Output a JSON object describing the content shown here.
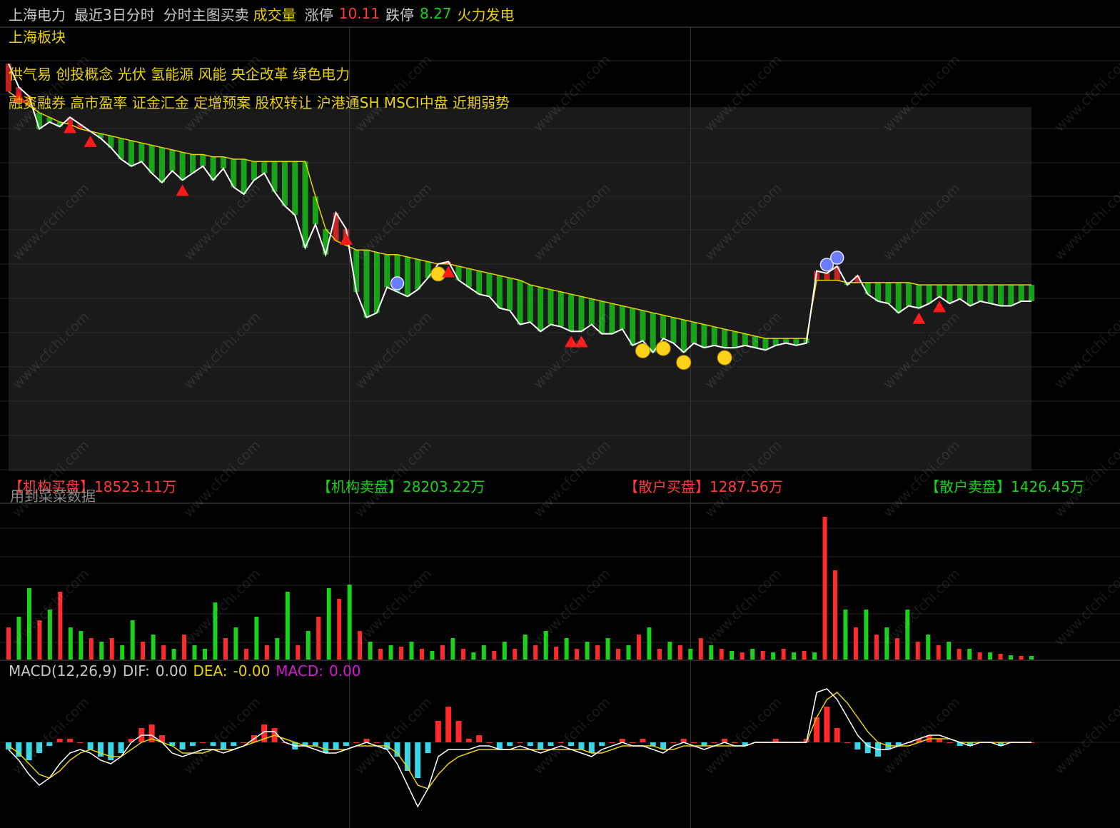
{
  "header": {
    "stock_name": "上海电力",
    "view_label": "最近3日分时",
    "indicator_label": "分时主图买卖",
    "volume_label": "成交量",
    "limit_up_label": "涨停",
    "limit_up_value": "10.11",
    "limit_down_label": "跌停",
    "limit_down_value": "8.27",
    "sector": "火力发电"
  },
  "tags": {
    "line1": "上海板块",
    "line2": "供气易 创投概念 光伏 氢能源 风能 央企改革 绿色电力",
    "line3": "融资融券 高市盈率 证金汇金 定增预案 股权转让 沪港通SH MSCI中盘 近期弱势"
  },
  "flow": {
    "inst_buy_label": "【机构买盘】",
    "inst_buy_value": "18523.11万",
    "inst_sell_label": "【机构卖盘】",
    "inst_sell_value": "28203.22万",
    "retail_buy_label": "【散户买盘】",
    "retail_buy_value": "1287.56万",
    "retail_sell_label": "【散户卖盘】",
    "retail_sell_value": "1426.45万",
    "note": "用到菜菜数据"
  },
  "macd": {
    "label": "MACD(12,26,9)",
    "dif_label": "DIF:",
    "dif_value": "0.00",
    "dea_label": "DEA:",
    "dea_value": "-0.00",
    "macd_label": "MACD:",
    "macd_value": "0.00"
  },
  "watermark": "www.cfchi.com",
  "colors": {
    "price": "#ffffff",
    "avg": "#e8d200",
    "up": "#ff2a2a",
    "down": "#19d219",
    "macd_neg": "#3ad6e6",
    "dea": "#e8d200",
    "dif": "#ffffff",
    "macd_value": "#d21ad2"
  },
  "chart_data": {
    "type": "line",
    "days": 3,
    "series": [
      {
        "name": "price",
        "values": [
          10.02,
          9.92,
          9.88,
          9.74,
          9.77,
          9.75,
          9.79,
          9.76,
          9.73,
          9.7,
          9.66,
          9.61,
          9.58,
          9.6,
          9.55,
          9.51,
          9.56,
          9.52,
          9.55,
          9.58,
          9.52,
          9.57,
          9.49,
          9.46,
          9.52,
          9.55,
          9.47,
          9.41,
          9.37,
          9.23,
          9.33,
          9.2,
          9.38,
          9.31,
          9.04,
          8.93,
          8.95,
          9.06,
          9.04,
          9.02,
          9.05,
          9.1,
          9.16,
          9.17,
          9.09,
          9.06,
          9.03,
          9.02,
          8.97,
          8.96,
          8.9,
          8.91,
          8.87,
          8.9,
          8.89,
          8.87,
          8.87,
          8.9,
          8.86,
          8.86,
          8.88,
          8.81,
          8.83,
          8.78,
          8.84,
          8.82,
          8.78,
          8.82,
          8.8,
          8.81,
          8.8,
          8.8,
          8.81,
          8.8,
          8.79,
          8.81,
          8.82,
          8.81,
          8.82,
          9.13,
          9.12,
          9.15,
          9.07,
          9.11,
          9.03,
          9.0,
          8.99,
          8.95,
          8.98,
          8.97,
          8.99,
          9.02,
          8.99,
          9.01,
          8.98,
          9.0,
          8.99,
          8.98,
          8.98,
          9.0,
          9.0
        ]
      },
      {
        "name": "average",
        "values": [
          9.9,
          9.87,
          9.84,
          9.81,
          9.79,
          9.77,
          9.76,
          9.74,
          9.73,
          9.72,
          9.71,
          9.7,
          9.69,
          9.68,
          9.67,
          9.66,
          9.65,
          9.64,
          9.63,
          9.63,
          9.62,
          9.62,
          9.61,
          9.61,
          9.6,
          9.6,
          9.6,
          9.6,
          9.6,
          9.6,
          9.45,
          9.31,
          9.26,
          9.24,
          9.22,
          9.22,
          9.21,
          9.2,
          9.2,
          9.19,
          9.18,
          9.17,
          9.16,
          9.16,
          9.15,
          9.14,
          9.13,
          9.12,
          9.11,
          9.1,
          9.09,
          9.07,
          9.06,
          9.05,
          9.04,
          9.03,
          9.02,
          9.01,
          9.0,
          8.99,
          8.98,
          8.97,
          8.96,
          8.95,
          8.94,
          8.93,
          8.92,
          8.91,
          8.9,
          8.89,
          8.88,
          8.87,
          8.86,
          8.85,
          8.84,
          8.84,
          8.84,
          8.84,
          8.84,
          9.09,
          9.09,
          9.09,
          9.08,
          9.08,
          9.08,
          9.08,
          9.08,
          9.08,
          9.08,
          9.07,
          9.07,
          9.07,
          9.07,
          9.07,
          9.07,
          9.07,
          9.07,
          9.07,
          9.07,
          9.07,
          9.07
        ]
      }
    ],
    "ylim": [
      8.27,
      10.11
    ],
    "volume": [
      {
        "d": "up",
        "v": 45
      },
      {
        "d": "down",
        "v": 60
      },
      {
        "d": "down",
        "v": 100
      },
      {
        "d": "up",
        "v": 55
      },
      {
        "d": "down",
        "v": 70
      },
      {
        "d": "up",
        "v": 95
      },
      {
        "d": "down",
        "v": 45
      },
      {
        "d": "down",
        "v": 40
      },
      {
        "d": "up",
        "v": 30
      },
      {
        "d": "down",
        "v": 25
      },
      {
        "d": "up",
        "v": 30
      },
      {
        "d": "down",
        "v": 20
      },
      {
        "d": "down",
        "v": 55
      },
      {
        "d": "up",
        "v": 25
      },
      {
        "d": "down",
        "v": 35
      },
      {
        "d": "up",
        "v": 20
      },
      {
        "d": "down",
        "v": 15
      },
      {
        "d": "up",
        "v": 35
      },
      {
        "d": "down",
        "v": 20
      },
      {
        "d": "down",
        "v": 15
      },
      {
        "d": "down",
        "v": 80
      },
      {
        "d": "up",
        "v": 30
      },
      {
        "d": "down",
        "v": 45
      },
      {
        "d": "up",
        "v": 15
      },
      {
        "d": "down",
        "v": 60
      },
      {
        "d": "up",
        "v": 20
      },
      {
        "d": "down",
        "v": 30
      },
      {
        "d": "down",
        "v": 95
      },
      {
        "d": "up",
        "v": 20
      },
      {
        "d": "down",
        "v": 40
      },
      {
        "d": "up",
        "v": 60
      },
      {
        "d": "down",
        "v": 100
      },
      {
        "d": "up",
        "v": 85
      },
      {
        "d": "down",
        "v": 105
      },
      {
        "d": "up",
        "v": 40
      },
      {
        "d": "down",
        "v": 25
      },
      {
        "d": "up",
        "v": 15
      },
      {
        "d": "down",
        "v": 20
      },
      {
        "d": "up",
        "v": 18
      },
      {
        "d": "down",
        "v": 25
      },
      {
        "d": "up",
        "v": 15
      },
      {
        "d": "down",
        "v": 12
      },
      {
        "d": "up",
        "v": 20
      },
      {
        "d": "down",
        "v": 30
      },
      {
        "d": "up",
        "v": 15
      },
      {
        "d": "down",
        "v": 10
      },
      {
        "d": "down",
        "v": 20
      },
      {
        "d": "up",
        "v": 12
      },
      {
        "d": "down",
        "v": 25
      },
      {
        "d": "up",
        "v": 15
      },
      {
        "d": "down",
        "v": 35
      },
      {
        "d": "up",
        "v": 20
      },
      {
        "d": "down",
        "v": 40
      },
      {
        "d": "up",
        "v": 18
      },
      {
        "d": "down",
        "v": 30
      },
      {
        "d": "up",
        "v": 15
      },
      {
        "d": "down",
        "v": 25
      },
      {
        "d": "up",
        "v": 20
      },
      {
        "d": "down",
        "v": 30
      },
      {
        "d": "up",
        "v": 15
      },
      {
        "d": "down",
        "v": 20
      },
      {
        "d": "up",
        "v": 35
      },
      {
        "d": "down",
        "v": 45
      },
      {
        "d": "up",
        "v": 15
      },
      {
        "d": "down",
        "v": 25
      },
      {
        "d": "up",
        "v": 20
      },
      {
        "d": "down",
        "v": 15
      },
      {
        "d": "up",
        "v": 30
      },
      {
        "d": "down",
        "v": 20
      },
      {
        "d": "up",
        "v": 15
      },
      {
        "d": "down",
        "v": 12
      },
      {
        "d": "up",
        "v": 10
      },
      {
        "d": "down",
        "v": 15
      },
      {
        "d": "up",
        "v": 12
      },
      {
        "d": "down",
        "v": 10
      },
      {
        "d": "up",
        "v": 15
      },
      {
        "d": "down",
        "v": 10
      },
      {
        "d": "up",
        "v": 12
      },
      {
        "d": "down",
        "v": 10
      },
      {
        "d": "up",
        "v": 200
      },
      {
        "d": "up",
        "v": 125
      },
      {
        "d": "down",
        "v": 70
      },
      {
        "d": "up",
        "v": 45
      },
      {
        "d": "down",
        "v": 70
      },
      {
        "d": "up",
        "v": 35
      },
      {
        "d": "down",
        "v": 45
      },
      {
        "d": "up",
        "v": 30
      },
      {
        "d": "down",
        "v": 70
      },
      {
        "d": "up",
        "v": 25
      },
      {
        "d": "down",
        "v": 35
      },
      {
        "d": "up",
        "v": 20
      },
      {
        "d": "down",
        "v": 25
      },
      {
        "d": "up",
        "v": 15
      },
      {
        "d": "down",
        "v": 15
      },
      {
        "d": "up",
        "v": 10
      },
      {
        "d": "down",
        "v": 10
      },
      {
        "d": "up",
        "v": 8
      },
      {
        "d": "down",
        "v": 6
      },
      {
        "d": "up",
        "v": 5
      },
      {
        "d": "down",
        "v": 5
      }
    ],
    "macd": {
      "bars": [
        -0.02,
        -0.04,
        -0.05,
        -0.03,
        -0.01,
        0.01,
        0.01,
        0.0,
        -0.02,
        -0.04,
        -0.05,
        -0.03,
        0.01,
        0.04,
        0.05,
        0.02,
        -0.01,
        -0.02,
        -0.01,
        0.0,
        -0.01,
        -0.02,
        -0.01,
        0.0,
        0.02,
        0.05,
        0.04,
        0.0,
        -0.02,
        -0.01,
        -0.01,
        -0.03,
        -0.02,
        -0.01,
        0.0,
        0.01,
        0.0,
        -0.02,
        -0.04,
        -0.08,
        -0.1,
        -0.03,
        0.06,
        0.1,
        0.06,
        0.01,
        0.02,
        0.0,
        -0.02,
        -0.01,
        0.0,
        -0.01,
        -0.02,
        -0.01,
        0.0,
        -0.01,
        -0.02,
        -0.03,
        -0.01,
        0.0,
        0.01,
        0.0,
        0.01,
        -0.01,
        -0.02,
        0.0,
        0.01,
        0.0,
        -0.01,
        0.0,
        0.01,
        0.0,
        -0.01,
        0.0,
        0.0,
        0.01,
        0.0,
        0.0,
        0.01,
        0.07,
        0.1,
        0.04,
        0.0,
        -0.02,
        -0.03,
        -0.04,
        -0.02,
        -0.01,
        0.0,
        0.01,
        0.02,
        0.01,
        0.0,
        -0.01,
        -0.01,
        0.0,
        0.0,
        -0.01,
        0.0,
        0.0,
        0.0
      ],
      "dif": [
        -0.02,
        -0.05,
        -0.09,
        -0.12,
        -0.1,
        -0.06,
        -0.03,
        -0.02,
        -0.03,
        -0.05,
        -0.06,
        -0.04,
        0.0,
        0.02,
        0.02,
        0.0,
        -0.03,
        -0.04,
        -0.03,
        -0.02,
        -0.02,
        -0.03,
        -0.02,
        -0.01,
        0.01,
        0.03,
        0.03,
        0.0,
        -0.01,
        -0.01,
        -0.02,
        -0.03,
        -0.03,
        -0.02,
        -0.01,
        0.0,
        -0.01,
        -0.02,
        -0.06,
        -0.12,
        -0.18,
        -0.13,
        -0.04,
        -0.02,
        -0.02,
        -0.02,
        -0.01,
        -0.01,
        -0.02,
        -0.02,
        -0.01,
        -0.02,
        -0.03,
        -0.02,
        -0.01,
        -0.02,
        -0.03,
        -0.04,
        -0.02,
        -0.01,
        0.0,
        -0.01,
        -0.01,
        -0.02,
        -0.03,
        -0.01,
        0.0,
        -0.01,
        -0.02,
        -0.01,
        0.0,
        -0.01,
        -0.01,
        0.0,
        0.0,
        0.0,
        0.0,
        0.0,
        0.0,
        0.14,
        0.15,
        0.12,
        0.07,
        0.02,
        -0.01,
        -0.02,
        -0.02,
        -0.01,
        0.0,
        0.01,
        0.02,
        0.02,
        0.01,
        0.0,
        -0.01,
        0.0,
        0.0,
        -0.01,
        0.0,
        0.0,
        0.0
      ],
      "dea": [
        -0.01,
        -0.03,
        -0.06,
        -0.09,
        -0.1,
        -0.08,
        -0.05,
        -0.03,
        -0.02,
        -0.03,
        -0.04,
        -0.04,
        -0.02,
        0.0,
        0.01,
        0.0,
        -0.01,
        -0.03,
        -0.03,
        -0.03,
        -0.02,
        -0.02,
        -0.02,
        -0.01,
        0.0,
        0.01,
        0.02,
        0.01,
        0.0,
        -0.01,
        -0.01,
        -0.02,
        -0.02,
        -0.02,
        -0.01,
        -0.01,
        -0.01,
        -0.01,
        -0.03,
        -0.07,
        -0.12,
        -0.13,
        -0.09,
        -0.06,
        -0.04,
        -0.03,
        -0.02,
        -0.02,
        -0.02,
        -0.02,
        -0.02,
        -0.02,
        -0.02,
        -0.02,
        -0.02,
        -0.02,
        -0.02,
        -0.03,
        -0.03,
        -0.02,
        -0.01,
        -0.01,
        -0.01,
        -0.01,
        -0.02,
        -0.02,
        -0.01,
        -0.01,
        -0.01,
        -0.01,
        -0.01,
        -0.01,
        -0.01,
        0.0,
        0.0,
        0.0,
        0.0,
        0.0,
        0.0,
        0.07,
        0.12,
        0.14,
        0.11,
        0.07,
        0.03,
        0.0,
        -0.01,
        -0.01,
        -0.01,
        0.0,
        0.01,
        0.01,
        0.01,
        0.0,
        0.0,
        0.0,
        0.0,
        0.0,
        0.0,
        0.0,
        0.0
      ]
    },
    "signals": [
      {
        "type": "buy",
        "i": 1
      },
      {
        "type": "buy",
        "i": 6
      },
      {
        "type": "buy",
        "i": 8
      },
      {
        "type": "buy",
        "i": 17
      },
      {
        "type": "buy",
        "i": 33
      },
      {
        "type": "sell",
        "i": 38
      },
      {
        "type": "smile",
        "i": 42
      },
      {
        "type": "buy",
        "i": 43
      },
      {
        "type": "buy",
        "i": 55
      },
      {
        "type": "buy",
        "i": 56
      },
      {
        "type": "smile",
        "i": 62
      },
      {
        "type": "smile",
        "i": 64
      },
      {
        "type": "smile",
        "i": 66
      },
      {
        "type": "smile",
        "i": 70
      },
      {
        "type": "sell",
        "i": 80
      },
      {
        "type": "sell",
        "i": 81
      },
      {
        "type": "buy",
        "i": 89
      },
      {
        "type": "buy",
        "i": 91
      }
    ]
  }
}
